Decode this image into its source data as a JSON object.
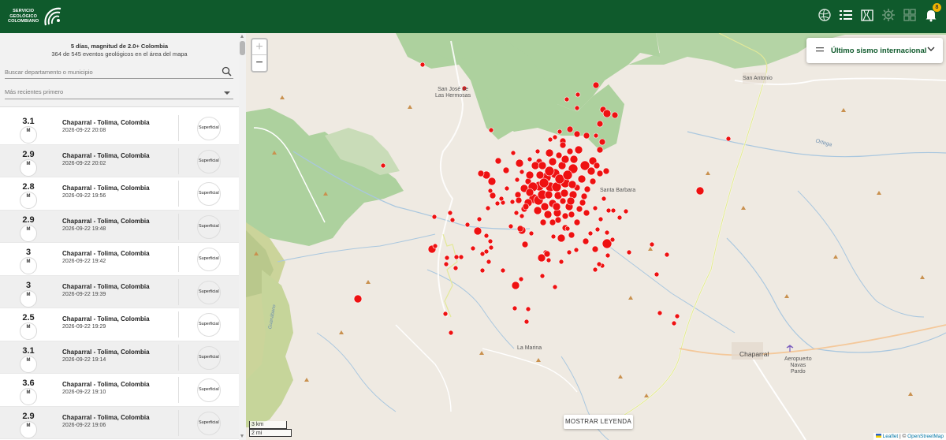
{
  "header": {
    "logo_lines": [
      "SERVICIO",
      "GEOLÓGICO",
      "COLOMBIANO"
    ],
    "notification_count": "8",
    "icons": [
      "globe-icon",
      "list-icon",
      "map-icon",
      "gear-icon",
      "grid-icon",
      "bell-icon"
    ]
  },
  "sidebar": {
    "title": "5 días, magnitud de 2.0+ Colombia",
    "subtitle": "364 de 545 eventos geológicos en el área del mapa",
    "search_placeholder": "Buscar departamento o municipio",
    "sort_value": "Más recientes primero",
    "events": [
      {
        "mag": "3.1",
        "unit": "M",
        "place": "Chaparral - Tolima, Colombia",
        "date": "2026-09-22 20:08",
        "depth": "Superficial"
      },
      {
        "mag": "2.9",
        "unit": "M",
        "place": "Chaparral - Tolima, Colombia",
        "date": "2026-09-22 20:02",
        "depth": "Superficial"
      },
      {
        "mag": "2.8",
        "unit": "M",
        "place": "Chaparral - Tolima, Colombia",
        "date": "2026-09-22 19:56",
        "depth": "Superficial"
      },
      {
        "mag": "2.9",
        "unit": "M",
        "place": "Chaparral - Tolima, Colombia",
        "date": "2026-09-22 19:48",
        "depth": "Superficial"
      },
      {
        "mag": "3",
        "unit": "M",
        "place": "Chaparral - Tolima, Colombia",
        "date": "2026-09-22 19:42",
        "depth": "Superficial"
      },
      {
        "mag": "3",
        "unit": "M",
        "place": "Chaparral - Tolima, Colombia",
        "date": "2026-09-22 19:39",
        "depth": "Superficial"
      },
      {
        "mag": "2.5",
        "unit": "M",
        "place": "Chaparral - Tolima, Colombia",
        "date": "2026-09-22 19:29",
        "depth": "Superficial"
      },
      {
        "mag": "3.1",
        "unit": "M",
        "place": "Chaparral - Tolima, Colombia",
        "date": "2026-09-22 19:14",
        "depth": "Superficial"
      },
      {
        "mag": "3.6",
        "unit": "M",
        "place": "Chaparral - Tolima, Colombia",
        "date": "2026-09-22 19:10",
        "depth": "Superficial"
      },
      {
        "mag": "2.9",
        "unit": "M",
        "place": "Chaparral - Tolima, Colombia",
        "date": "2026-09-22 19:06",
        "depth": "Superficial"
      }
    ]
  },
  "map": {
    "zoom_in": "+",
    "zoom_out": "−",
    "intl_button_label": "Último sismo internacional",
    "legend_button_label": "MOSTRAR LEYENDA",
    "scale_km": "3 km",
    "scale_mi": "2 mi",
    "attribution_leaflet": "Leaflet",
    "attribution_sep": " | © ",
    "attribution_osm": "OpenStreetMap",
    "places": {
      "san_jose_1": "San José de",
      "san_jose_2": "Las Hermosas",
      "san_antonio": "San Antonio",
      "santa_barbara": "Santa Barbara",
      "la_marina": "La Marina",
      "chaparral": "Chaparral",
      "aeropuerto_1": "Aeropuerto",
      "aeropuerto_2": "Navas",
      "aeropuerto_3": "Pardo",
      "ortega": "Ortega",
      "guanabano": "Guanábano"
    },
    "marker_color": "#ee1111"
  }
}
